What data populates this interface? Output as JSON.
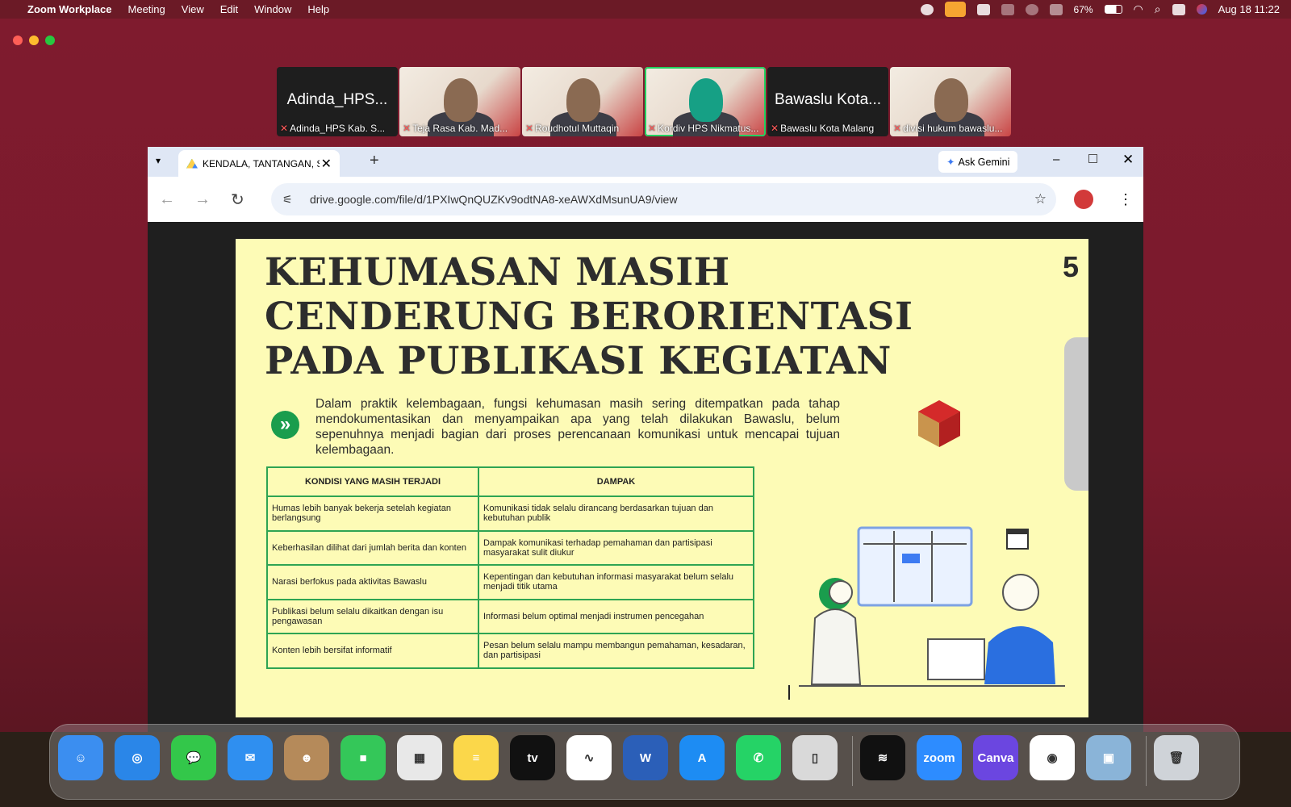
{
  "menubar": {
    "app": "Zoom Workplace",
    "items": [
      "Meeting",
      "View",
      "Edit",
      "Window",
      "Help"
    ],
    "battery": "67%",
    "datetime": "Aug 18  11:22"
  },
  "participants": [
    {
      "big": "Adinda_HPS...",
      "caption": "Adinda_HPS Kab. S...",
      "video": false
    },
    {
      "big": "",
      "caption": "Teja Rasa Kab. Mad...",
      "video": true
    },
    {
      "big": "",
      "caption": "Roudhotul Muttaqin",
      "video": true
    },
    {
      "big": "",
      "caption": "Kordiv HPS Nikmatus...",
      "video": true,
      "active": true
    },
    {
      "big": "Bawaslu Kota...",
      "caption": "Bawaslu Kota Malang",
      "video": false
    },
    {
      "big": "",
      "caption": "divisi hukum bawaslu...",
      "video": true
    }
  ],
  "browser": {
    "tab_title": "KENDALA, TANTANGAN, SEI",
    "ask_gemini": "Ask Gemini",
    "url": "drive.google.com/file/d/1PXIwQnQUZKv9odtNA8-xeAWXdMsunUA9/view"
  },
  "slide": {
    "title_lines": [
      "KEHUMASAN MASIH",
      "CENDERUNG BERORIENTASI",
      "PADA PUBLIKASI KEGIATAN"
    ],
    "number": "5",
    "paragraph": "Dalam praktik kelembagaan, fungsi kehumasan masih sering ditempatkan pada tahap mendokumentasikan dan menyampaikan apa yang telah dilakukan Bawaslu, belum sepenuhnya menjadi bagian dari proses perencanaan komunikasi untuk mencapai tujuan kelembagaan.",
    "table": {
      "headers": [
        "KONDISI YANG MASIH TERJADI",
        "DAMPAK"
      ],
      "rows": [
        [
          "Humas lebih banyak bekerja setelah kegiatan berlangsung",
          "Komunikasi tidak selalu dirancang berdasarkan tujuan dan kebutuhan publik"
        ],
        [
          "Keberhasilan dilihat dari jumlah berita dan konten",
          "Dampak komunikasi terhadap pemahaman dan partisipasi masyarakat sulit diukur"
        ],
        [
          "Narasi berfokus pada aktivitas Bawaslu",
          "Kepentingan dan kebutuhan informasi masyarakat belum selalu menjadi titik utama"
        ],
        [
          "Publikasi belum selalu dikaitkan dengan isu pengawasan",
          "Informasi belum optimal menjadi instrumen pencegahan"
        ],
        [
          "Konten lebih bersifat informatif",
          "Pesan belum selalu mampu membangun pemahaman, kesadaran, dan partisipasi"
        ]
      ]
    }
  },
  "dock": {
    "apps": [
      {
        "name": "finder",
        "color": "#3b8ef0",
        "glyph": "☺"
      },
      {
        "name": "safari",
        "color": "#2a86e8",
        "glyph": "◎"
      },
      {
        "name": "messages",
        "color": "#33c74a",
        "glyph": "💬"
      },
      {
        "name": "mail",
        "color": "#2f8ff0",
        "glyph": "✉"
      },
      {
        "name": "contacts",
        "color": "#b58a5a",
        "glyph": "☻"
      },
      {
        "name": "facetime",
        "color": "#34c759",
        "glyph": "■"
      },
      {
        "name": "launchpad",
        "color": "#e8e8e8",
        "glyph": "▦"
      },
      {
        "name": "notes",
        "color": "#fbd74a",
        "glyph": "≡"
      },
      {
        "name": "appletv",
        "color": "#111111",
        "glyph": "tv"
      },
      {
        "name": "freeform",
        "color": "#ffffff",
        "glyph": "∿"
      },
      {
        "name": "word",
        "color": "#2b5fb8",
        "glyph": "W"
      },
      {
        "name": "appstore",
        "color": "#1d8cf3",
        "glyph": "A"
      },
      {
        "name": "whatsapp",
        "color": "#25d366",
        "glyph": "✆"
      },
      {
        "name": "iphone-mirroring",
        "color": "#d9d9d9",
        "glyph": "▯"
      },
      {
        "name": "spotify",
        "color": "#111111",
        "glyph": "≋"
      },
      {
        "name": "zoom",
        "color": "#2d8cff",
        "glyph": "zoom"
      },
      {
        "name": "canva",
        "color": "#6b46e0",
        "glyph": "Canva"
      },
      {
        "name": "chrome",
        "color": "#ffffff",
        "glyph": "◉"
      },
      {
        "name": "preview",
        "color": "#8ab4d8",
        "glyph": "▣"
      },
      {
        "name": "trash",
        "color": "#cfd3d8",
        "glyph": "🗑"
      }
    ]
  }
}
